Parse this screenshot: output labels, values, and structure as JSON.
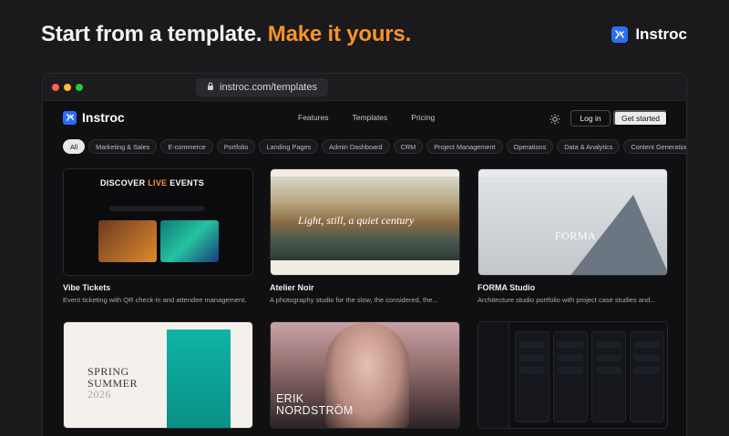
{
  "hero": {
    "part1": "Start from a template.",
    "part2": "Make it yours."
  },
  "brand": {
    "name": "Instroc",
    "accent": "#2b6ef5",
    "highlight": "#f7932b"
  },
  "browser": {
    "url": "instroc.com/templates"
  },
  "nav": {
    "brand": "Instroc",
    "links": [
      "Features",
      "Templates",
      "Pricing"
    ],
    "theme_icon": "sun-icon",
    "login": "Log in",
    "get_started": "Get started"
  },
  "categories": [
    "All",
    "Marketing & Sales",
    "E-commerce",
    "Portfolio",
    "Landing Pages",
    "Admin Dashboard",
    "CRM",
    "Project Management",
    "Operations",
    "Data & Analytics",
    "Content Generation"
  ],
  "active_category": "All",
  "templates": [
    {
      "title": "Vibe Tickets",
      "desc": "Event ticketing with QR check-in and attendee management.",
      "thumb_heading_a": "DISCOVER ",
      "thumb_heading_b": "LIVE",
      "thumb_heading_c": " EVENTS"
    },
    {
      "title": "Atelier Noir",
      "desc": "A photography studio for the slow, the considered, the...",
      "thumb_text": "Light, still, a quiet century"
    },
    {
      "title": "FORMA Studio",
      "desc": "Architecture studio portfolio with project case studies and...",
      "thumb_text": "FORMA"
    },
    {
      "title": "",
      "desc": "",
      "thumb_line1": "SPRING",
      "thumb_line2": "SUMMER",
      "thumb_line3": "2026"
    },
    {
      "title": "",
      "desc": "",
      "thumb_line1": "ERIK",
      "thumb_line2": "NORDSTRÖM"
    },
    {
      "title": "",
      "desc": ""
    }
  ]
}
